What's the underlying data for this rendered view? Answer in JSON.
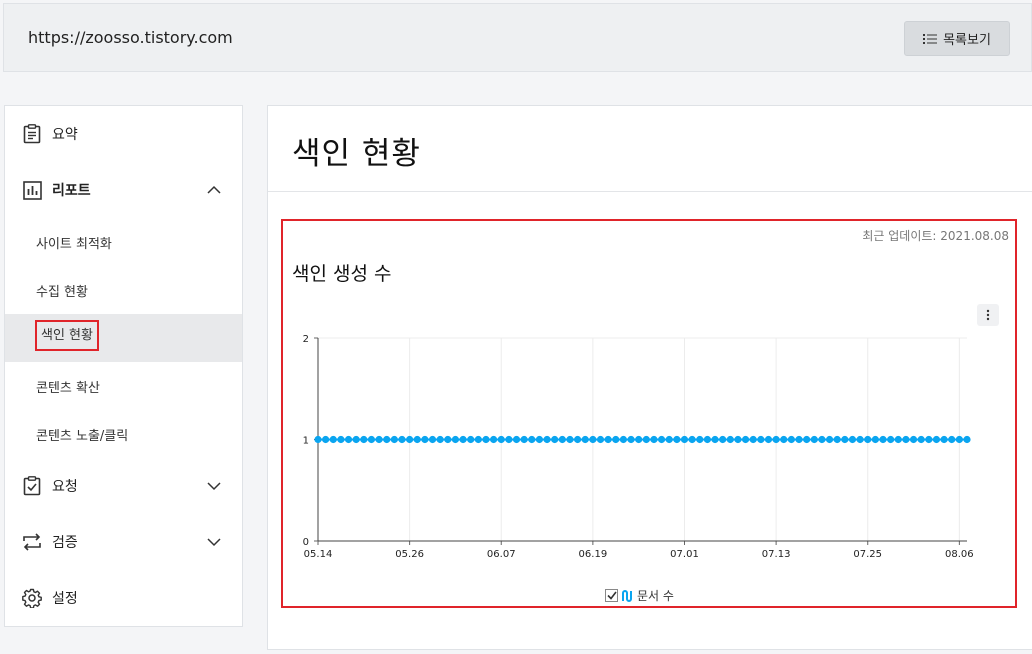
{
  "header": {
    "site_url": "https://zoosso.tistory.com",
    "list_button_label": "목록보기"
  },
  "sidebar": {
    "items": [
      {
        "label": "요약",
        "icon": "clipboard-icon"
      },
      {
        "label": "리포트",
        "icon": "bar-chart-icon",
        "expanded": true
      },
      {
        "label": "요청",
        "icon": "checklist-icon",
        "expanded": false
      },
      {
        "label": "검증",
        "icon": "repeat-icon",
        "expanded": false
      },
      {
        "label": "설정",
        "icon": "gear-icon"
      }
    ],
    "report_subitems": [
      {
        "label": "사이트 최적화"
      },
      {
        "label": "수집 현황"
      },
      {
        "label": "색인 현황",
        "active": true
      },
      {
        "label": "콘텐츠 확산"
      },
      {
        "label": "콘텐츠 노출/클릭"
      }
    ]
  },
  "main": {
    "page_title": "색인 현황",
    "update_label": "최근 업데이트: 2021.08.08",
    "chart_title": "색인 생성 수"
  },
  "chart_data": {
    "type": "line",
    "title": "색인 생성 수",
    "xlabel": "",
    "ylabel": "",
    "ylim": [
      0,
      2
    ],
    "yticks": [
      "0",
      "1",
      "2"
    ],
    "xticks": [
      "05.14",
      "05.26",
      "06.07",
      "06.19",
      "07.01",
      "07.13",
      "07.25",
      "08.06"
    ],
    "x_range": [
      "05.14",
      "08.07"
    ],
    "series": [
      {
        "name": "문서 수",
        "constant_value": 1,
        "point_count": 86,
        "color": "#0aa5f0"
      }
    ],
    "legend_position": "bottom",
    "grid": true
  }
}
